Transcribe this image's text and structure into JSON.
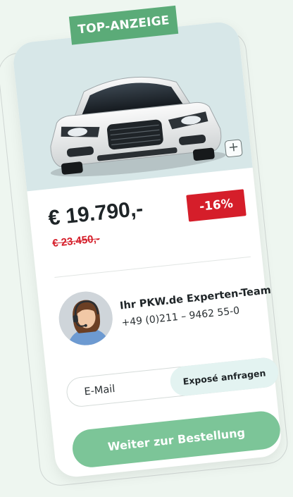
{
  "listing": {
    "badge": "TOP-ANZEIGE",
    "price": "€ 19.790,-",
    "old_price": "€ 23.450,-",
    "discount": "-16%",
    "zoom_symbol": "+"
  },
  "contact": {
    "name": "Ihr PKW.de Experten-Team",
    "phone": "+49 (0)211 – 9462 55-0"
  },
  "expose_form": {
    "email_placeholder": "E-Mail",
    "request_label": "Exposé anfragen"
  },
  "order": {
    "label": "Weiter zur Bestellung"
  },
  "colors": {
    "accent_green": "#5bab78",
    "button_green": "#7cc598",
    "discount_red": "#d51e2a",
    "expose_bg": "#e3f3f1",
    "page_bg": "#eef6f0"
  },
  "icons": {
    "zoom": "plus-icon",
    "avatar": "agent-headset-avatar"
  }
}
